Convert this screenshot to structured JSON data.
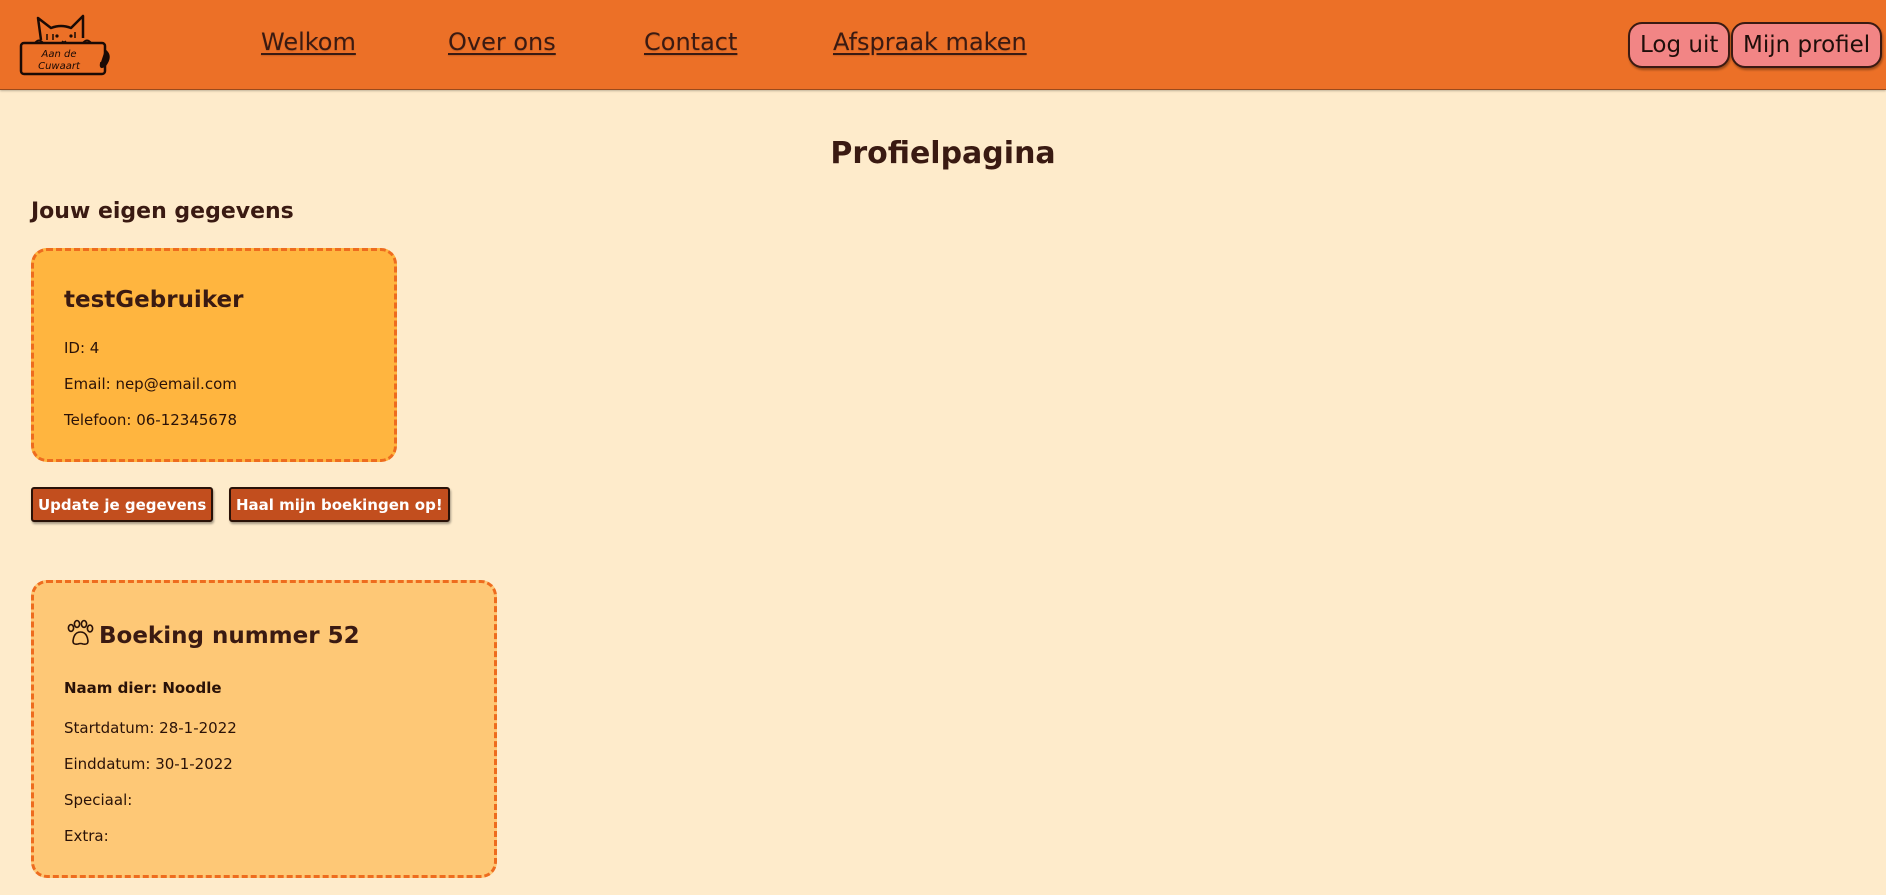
{
  "header": {
    "logo": {
      "icon": "cat-logo-icon",
      "text_line1": "Aan de",
      "text_line2": "Cuwaart"
    },
    "nav": [
      {
        "label": "Welkom"
      },
      {
        "label": "Over ons"
      },
      {
        "label": "Contact"
      },
      {
        "label": "Afspraak maken"
      }
    ],
    "logout_label": "Log uit",
    "profile_label": "Mijn profiel"
  },
  "page": {
    "title": "Profielpagina",
    "section_title": "Jouw eigen gegevens"
  },
  "user": {
    "name": "testGebruiker",
    "id_line": "ID: 4",
    "email_line": "Email: nep@email.com",
    "phone_line": "Telefoon: 06-12345678"
  },
  "actions": {
    "update_label": "Update je gegevens",
    "bookings_label": "Haal mijn boekingen op!"
  },
  "booking": {
    "icon": "paw-icon",
    "title": "Boeking nummer 52",
    "pet_line": "Naam dier: Noodle",
    "start_line": "Startdatum: 28-1-2022",
    "end_line": "Einddatum: 30-1-2022",
    "special_line": "Speciaal:",
    "extra_line": "Extra:"
  },
  "colors": {
    "navbar": "#ec7027",
    "background": "#feebcb",
    "user_card": "#ffb53f",
    "booking_card": "#fec876",
    "card_border": "#ee6c1e",
    "auth_button": "#f28585",
    "action_button": "#c24e1e",
    "text": "#3a1a12"
  }
}
